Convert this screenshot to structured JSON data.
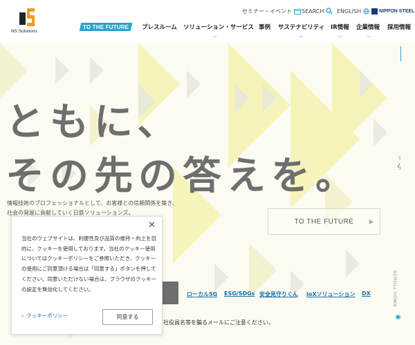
{
  "header": {
    "logo_text": "NS Solutions",
    "util": {
      "seminar": "セミナー・イベント",
      "search": "SEARCH",
      "english": "ENGLISH",
      "nippon_steel": "NIPPON STEEL"
    },
    "future_tag": "TO THE FUTURE",
    "nav": [
      "プレスルーム",
      "ソリューション・サービス",
      "事例",
      "サステナビリティ",
      "IR情報",
      "企業情報",
      "採用情報"
    ]
  },
  "hero": {
    "headline_line1": "ともに、",
    "headline_line2": "その先の答えを。",
    "sub_line1": "情報技術のプロフェッショナルとして、お客様との信頼関係を築き、",
    "sub_line2": "社会の発展に貢献していく日鉄ソリューションズ。",
    "future_button": "TO THE FUTURE",
    "pager_current": "1",
    "pager_total": "5",
    "scroll_down": "SCROLL DOWN"
  },
  "tags": [
    "ローカル5G",
    "ESG/SDGs",
    "安全見守りくん",
    "IoXソリューション",
    "DX"
  ],
  "notice": "社役員名等を騙るメールにご注意ください。",
  "cookie": {
    "text": "当社のウェブサイトは、利便性及び品質の維持・向上を目的に、クッキーを使用しております。当社のクッキー使用についてはクッキーポリシーをご参照いただき、クッキーの使用にご同意頂ける場合は「同意する」ボタンを押してください。同意いただけない場合は、ブラウザのクッキーの設定を無効化してください。",
    "policy_link": "クッキーポリシー",
    "agree_button": "同意する"
  },
  "colors": {
    "accent": "#29a3c9",
    "link": "#1670a8",
    "headline": "#6e6e6e",
    "hero_yellow": "#f4f1a8"
  }
}
